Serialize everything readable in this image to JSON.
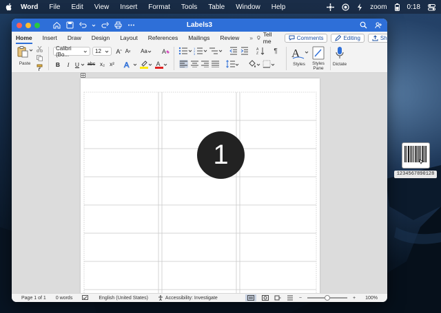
{
  "menubar": {
    "app_name": "Word",
    "items": [
      "File",
      "Edit",
      "View",
      "Insert",
      "Format",
      "Tools",
      "Table",
      "Window",
      "Help"
    ],
    "zoom_label": "zoom",
    "battery_time": "0:18"
  },
  "window": {
    "title": "Labels3"
  },
  "ribbon": {
    "tabs": [
      "Home",
      "Insert",
      "Draw",
      "Design",
      "Layout",
      "References",
      "Mailings",
      "Review"
    ],
    "tell_me": "Tell me",
    "comments_label": "Comments",
    "editing_label": "Editing",
    "share_label": "Share",
    "paste_label": "Paste",
    "font_name": "Calibri (Bo...",
    "font_size": "12",
    "styles_label": "Styles",
    "styles_pane_label": "Styles Pane",
    "dictate_label": "Dictate",
    "font_case": "Aa",
    "bold": "B",
    "italic": "I",
    "underline": "U",
    "strike": "abc",
    "subscript": "x₂",
    "superscript": "x²"
  },
  "document": {
    "overlay_number": "1"
  },
  "statusbar": {
    "page": "Page 1 of 1",
    "words": "0 words",
    "language": "English (United States)",
    "accessibility": "Accessibility: Investigate",
    "zoom": "100%",
    "zoom_minus": "−",
    "zoom_plus": "+"
  },
  "desktop": {
    "barcode_number": "1234567890128"
  },
  "colors": {
    "titlebar": "#2e6fd8",
    "accent": "#2e6fd8"
  }
}
